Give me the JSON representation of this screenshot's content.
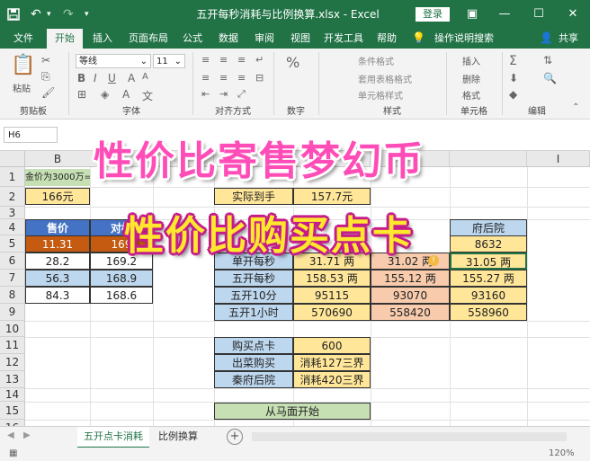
{
  "titlebar": {
    "title": "五开每秒消耗与比例换算.xlsx  -  Excel",
    "login": "登录",
    "save_icon": "save-icon",
    "undo_icon": "undo-icon",
    "redo_icon": "redo-icon",
    "qa_customize": "▾",
    "minimize": "—",
    "maximize": "☐",
    "close": "✕",
    "ribbon_display": "▣"
  },
  "tabs": [
    "文件",
    "开始",
    "插入",
    "页面布局",
    "公式",
    "数据",
    "审阅",
    "视图",
    "开发工具",
    "帮助",
    "操作说明搜索",
    "共享"
  ],
  "ribbon": {
    "paste": "粘贴",
    "clipboard": "剪贴板",
    "font_name": "等线",
    "font_size": "11",
    "font": "字体",
    "align": "对齐方式",
    "number": "数字",
    "cond_format": "条件格式",
    "table_format": "套用表格格式",
    "cell_style": "单元格样式",
    "styles": "样式",
    "insert": "插入",
    "delete": "删除",
    "format": "格式",
    "cells": "单元格",
    "editing": "编辑"
  },
  "formula_bar": {
    "namebox": "H6"
  },
  "overlay": {
    "line1": "性价比寄售梦幻币",
    "line2": "性价比购买点卡"
  },
  "columns": [
    "B",
    "I"
  ],
  "rows": [
    "1",
    "2",
    "3",
    "4",
    "5",
    "6",
    "7",
    "8",
    "9",
    "10",
    "11",
    "12",
    "13",
    "14",
    "15",
    "16"
  ],
  "cells": {
    "a1": "金价为3000万=",
    "b2": "166元",
    "fact_label": "实际到手",
    "fact_value": "157.7元",
    "price_header": "售价",
    "ratio_header": "对标",
    "price_row5": "11.31",
    "ratio_row5": "169",
    "price_row6": "28.2",
    "ratio_row6": "169.2",
    "price_row7": "56.3",
    "ratio_row7": "168.9",
    "price_row8": "84.3",
    "ratio_row8": "168.6",
    "qinfu_header": "府后院",
    "qinfu_row5": "8632",
    "row6_label": "单开每秒",
    "row6_v1": "31.71 两",
    "row6_v2": "31.02 两",
    "row6_v3": "31.05 两",
    "row7_label": "五开每秒",
    "row7_v1": "158.53 两",
    "row7_v2": "155.12 两",
    "row7_v3": "155.27 两",
    "row8_label": "五开10分",
    "row8_v1": "95115",
    "row8_v2": "93070",
    "row8_v3": "93160",
    "row9_label": "五开1小时",
    "row9_v1": "570690",
    "row9_v2": "558420",
    "row9_v3": "558960",
    "buy_card": "购买点卡",
    "buy_card_value": "600",
    "chucai": "出菜购买",
    "chucai_value": "消耗127三界",
    "qinfu": "秦府后院",
    "qinfu_value": "消耗420三界",
    "start": "从马面开始"
  },
  "sheets": [
    "五开点卡消耗",
    "比例换算"
  ],
  "status": {
    "zoom": "120%"
  }
}
